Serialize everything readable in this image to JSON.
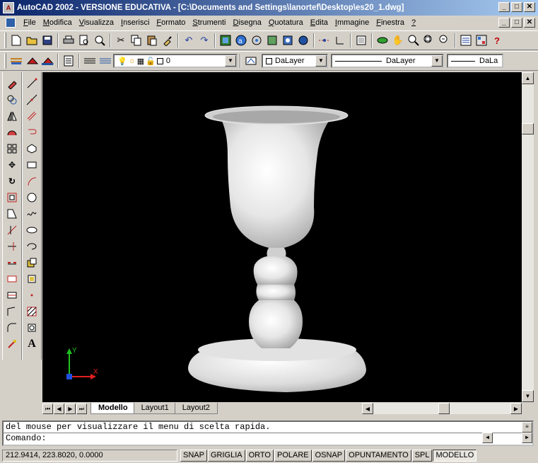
{
  "window": {
    "app_icon_label": "A",
    "title": "AutoCAD 2002 - VERSIONE EDUCATIVA - [C:\\Documents and Settings\\lanortef\\Desktop\\es20_1.dwg]"
  },
  "title_buttons": [
    "_",
    "□",
    "✕"
  ],
  "menu": {
    "items": [
      {
        "accel": "F",
        "rest": "ile"
      },
      {
        "accel": "M",
        "rest": "odifica"
      },
      {
        "accel": "V",
        "rest": "isualizza"
      },
      {
        "accel": "I",
        "rest": "nserisci"
      },
      {
        "accel": "F",
        "rest": "ormato"
      },
      {
        "accel": "S",
        "rest": "trumenti"
      },
      {
        "accel": "D",
        "rest": "isegna"
      },
      {
        "accel": "Q",
        "rest": "uotatura"
      },
      {
        "accel": "E",
        "rest": "dita"
      },
      {
        "accel": "I",
        "rest": "mmagine"
      },
      {
        "accel": "F",
        "rest": "inestra"
      },
      {
        "accel": "?",
        "rest": ""
      }
    ]
  },
  "layer_toolbar": {
    "layer_name": "0",
    "color_value": "DaLayer",
    "linetype_value": "DaLayer",
    "lineweight_value": "DaLa"
  },
  "layout_tabs": [
    "Modello",
    "Layout1",
    "Layout2"
  ],
  "ucs": {
    "x_label": "X",
    "y_label": "Y"
  },
  "command": {
    "history": "del mouse per visualizzare il menu di scelta rapida.",
    "prompt": "Comando:"
  },
  "status": {
    "coords": "212.9414, 223.8020, 0.0000",
    "toggles": [
      {
        "label": "SNAP",
        "on": false
      },
      {
        "label": "GRIGLIA",
        "on": false
      },
      {
        "label": "ORTO",
        "on": false
      },
      {
        "label": "POLARE",
        "on": false
      },
      {
        "label": "OSNAP",
        "on": false
      },
      {
        "label": "OPUNTAMENTO",
        "on": false
      },
      {
        "label": "SPL",
        "on": false
      },
      {
        "label": "MODELLO",
        "on": true
      }
    ]
  },
  "colors": {
    "title_start": "#0a246a",
    "title_end": "#a6caf0",
    "chrome": "#d4d0c8",
    "canvas": "#000000"
  }
}
